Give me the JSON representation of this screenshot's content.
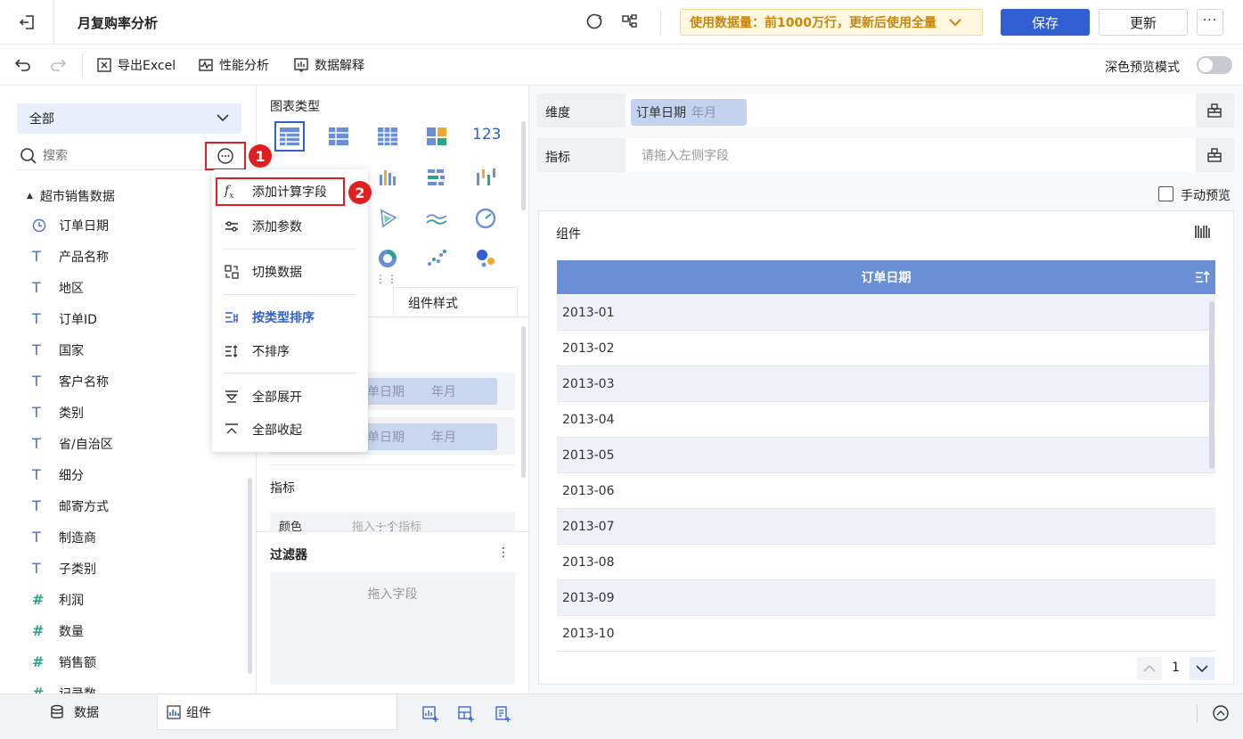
{
  "topbar": {
    "title": "月复购率分析",
    "data_usage_notice": "使用数据量：前1000万行，更新后使用全量",
    "save_label": "保存",
    "update_label": "更新"
  },
  "toolbar": {
    "export_excel": "导出Excel",
    "perf_analysis": "性能分析",
    "data_explain": "数据解释",
    "dark_preview": "深色预览模式"
  },
  "left_panel": {
    "dataset_select": "全部",
    "search_placeholder": "搜索",
    "group_name": "超市销售数据",
    "fields": [
      {
        "name": "订单日期",
        "type": "date-icon"
      },
      {
        "name": "产品名称",
        "type": "text-icon"
      },
      {
        "name": "地区",
        "type": "text-icon"
      },
      {
        "name": "订单ID",
        "type": "text-icon"
      },
      {
        "name": "国家",
        "type": "text-icon"
      },
      {
        "name": "客户名称",
        "type": "text-icon"
      },
      {
        "name": "类别",
        "type": "text-icon"
      },
      {
        "name": "省/自治区",
        "type": "text-icon"
      },
      {
        "name": "细分",
        "type": "text-icon"
      },
      {
        "name": "邮寄方式",
        "type": "text-icon"
      },
      {
        "name": "制造商",
        "type": "text-icon"
      },
      {
        "name": "子类别",
        "type": "text-icon"
      },
      {
        "name": "利润",
        "type": "number-icon"
      },
      {
        "name": "数量",
        "type": "number-icon"
      },
      {
        "name": "销售额",
        "type": "number-icon"
      },
      {
        "name": "记录数",
        "type": "number-icon"
      }
    ]
  },
  "context_menu": {
    "items": [
      "添加计算字段",
      "添加参数",
      "切换数据",
      "按类型排序",
      "不排序",
      "全部展开",
      "全部收起"
    ],
    "active_item": "按类型排序"
  },
  "annotations": {
    "badge1": "1",
    "badge2": "2"
  },
  "mid_panel": {
    "chart_type_label": "图表类型",
    "number_chart_label": "123",
    "tab_style": "组件样式",
    "dim_pill_field": "单日期",
    "dim_pill_unit": "年月",
    "dim_pill2_field": "单日期",
    "dim_pill2_unit": "年月",
    "metric_label": "指标",
    "color_label": "颜色",
    "color_placeholder": "拖入一个指标",
    "filter_label": "过滤器",
    "filter_placeholder": "拖入字段"
  },
  "right_panel": {
    "dimension_label": "维度",
    "dimension_field": "订单日期",
    "dimension_unit": "年月",
    "metric_label": "指标",
    "metric_placeholder": "请拖入左侧字段",
    "manual_preview": "手动预览",
    "component_title": "组件",
    "table_header": "订单日期",
    "rows": [
      "2013-01",
      "2013-02",
      "2013-03",
      "2013-04",
      "2013-05",
      "2013-06",
      "2013-07",
      "2013-08",
      "2013-09",
      "2013-10"
    ],
    "page_number": "1"
  },
  "bottombar": {
    "tab_data": "数据",
    "tab_component": "组件"
  },
  "colors": {
    "primary": "#2f5fd0",
    "table_header": "#6b8fd6",
    "highlight": "#e02020",
    "notice_bg": "#fff7e0"
  }
}
